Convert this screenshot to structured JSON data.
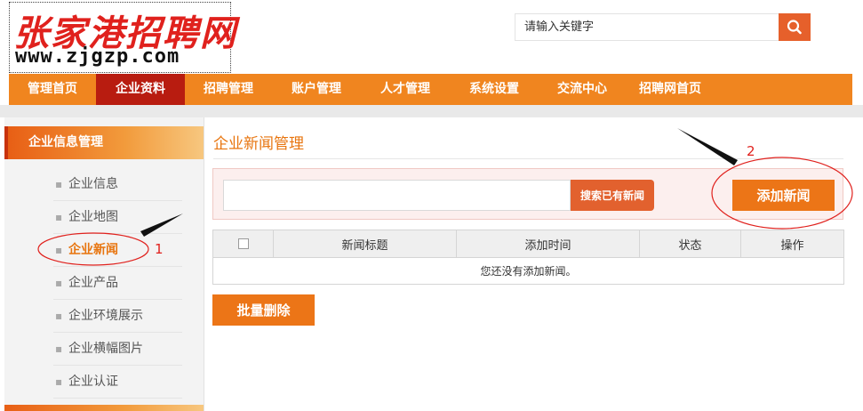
{
  "header": {
    "logo_cn": "张家港招聘网",
    "logo_url": "www.zjgzp.com",
    "search_placeholder": "请输入关键字"
  },
  "nav": {
    "items": [
      {
        "label": "管理首页",
        "active": false
      },
      {
        "label": "企业资料",
        "active": true
      },
      {
        "label": "招聘管理",
        "active": false
      },
      {
        "label": "账户管理",
        "active": false
      },
      {
        "label": "人才管理",
        "active": false
      },
      {
        "label": "系统设置",
        "active": false
      },
      {
        "label": "交流中心",
        "active": false
      },
      {
        "label": "招聘网首页",
        "active": false
      }
    ]
  },
  "sidebar": {
    "title": "企业信息管理",
    "items": [
      {
        "label": "企业信息",
        "active": false
      },
      {
        "label": "企业地图",
        "active": false
      },
      {
        "label": "企业新闻",
        "active": true
      },
      {
        "label": "企业产品",
        "active": false
      },
      {
        "label": "企业环境展示",
        "active": false
      },
      {
        "label": "企业横幅图片",
        "active": false
      },
      {
        "label": "企业认证",
        "active": false
      }
    ]
  },
  "main": {
    "title": "企业新闻管理",
    "search_button": "搜索已有新闻",
    "add_button": "添加新闻",
    "table": {
      "headers": [
        "新闻标题",
        "添加时间",
        "状态",
        "操作"
      ],
      "empty_text": "您还没有添加新闻。"
    },
    "batch_delete": "批量删除"
  },
  "annotations": {
    "step1": "1",
    "step2": "2"
  },
  "colors": {
    "nav_bg": "#f0851f",
    "nav_active": "#b81c10",
    "accent": "#e8750f",
    "button": "#ec7517",
    "annotation": "#e0211d"
  }
}
